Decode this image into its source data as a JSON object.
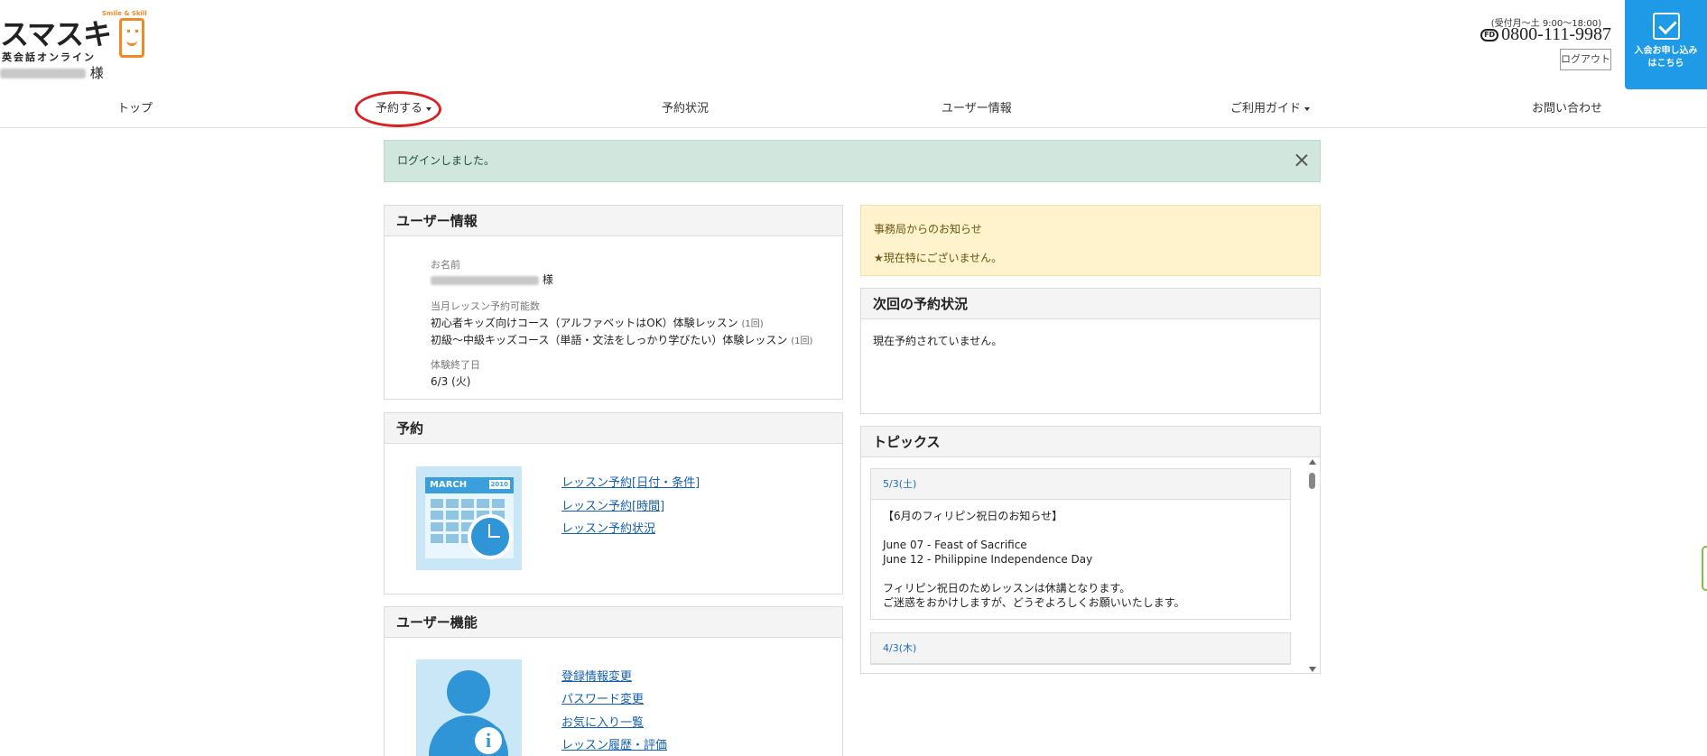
{
  "header": {
    "logo_brand": "スマスキ",
    "logo_tagline": "Smile & Skill",
    "logo_sub": "英会話オンライン",
    "username_suffix": "様",
    "hours": "(受付月〜土 9:00〜18:00)",
    "phone_icon": "free-dial-icon",
    "phone": "0800-111-9987",
    "logout_label": "ログアウト",
    "join_label": "入会お申し込みはこちら"
  },
  "nav": {
    "items": [
      {
        "label": "トップ"
      },
      {
        "label": "予約する"
      },
      {
        "label": "予約状況"
      },
      {
        "label": "ユーザー情報"
      },
      {
        "label": "ご利用ガイド"
      },
      {
        "label": "お問い合わせ"
      }
    ]
  },
  "alert": {
    "message": "ログインしました。"
  },
  "user_info": {
    "title": "ユーザー情報",
    "name_label": "お名前",
    "name_suffix": "様",
    "lessons_label": "当月レッスン予約可能数",
    "lessons": [
      {
        "name": "初心者キッズ向けコース（アルファベットはOK）体験レッスン",
        "count": "(1回)"
      },
      {
        "name": "初級〜中級キッズコース（単語・文法をしっかり学びたい）体験レッスン",
        "count": "(1回)"
      }
    ],
    "trial_end_label": "体験終了日",
    "trial_end_value": "6/3 (火)"
  },
  "reservation": {
    "title": "予約",
    "image": {
      "month": "MARCH",
      "year": "2010"
    },
    "links": [
      "レッスン予約[日付・条件]",
      "レッスン予約[時間]",
      "レッスン予約状況"
    ]
  },
  "user_functions": {
    "title": "ユーザー機能",
    "links": [
      "登録情報変更",
      "パスワード変更",
      "お気に入り一覧",
      "レッスン履歴・評価"
    ]
  },
  "notice": {
    "title": "事務局からのお知らせ",
    "message": "★現在特にございません。"
  },
  "next_reservation": {
    "title": "次回の予約状況",
    "message": "現在予約されていません。"
  },
  "topics": {
    "title": "トピックス",
    "items": [
      {
        "date": "5/3(土)",
        "lines": [
          "【6月のフィリピン祝日のお知らせ】",
          "",
          "June 07 - Feast of Sacrifice",
          "June 12 - Philippine Independence Day",
          "",
          "フィリピン祝日のためレッスンは休講となります。",
          "ご迷惑をおかけしますが、どうぞよろしくお願いいたします。"
        ]
      },
      {
        "date": "4/3(木)",
        "lines": []
      }
    ]
  },
  "colors": {
    "join_bg": "#1e9ae6",
    "alert_bg": "#d1e7dd",
    "notice_bg": "#fff3cd",
    "link": "#1560b0",
    "highlight_ring": "#d92023"
  }
}
